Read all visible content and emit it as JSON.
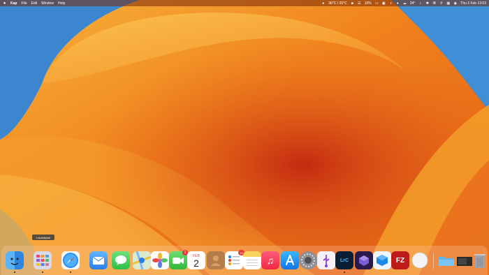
{
  "menubar": {
    "app_name": "Kap",
    "menus": [
      "File",
      "Edit",
      "Window",
      "Help"
    ],
    "temperature": "36°C / 35°C",
    "battery": "10%",
    "weather_temp": "34°",
    "datetime": "Thu 2 Feb  13:03"
  },
  "tooltip": {
    "text": "Launchpad"
  },
  "dock": {
    "calendar_month": "FEB",
    "calendar_day": "2",
    "facetime_badge": "1",
    "reminders_badge": "12",
    "lightroom_label": "LrC",
    "filezilla_label": "FZ"
  }
}
